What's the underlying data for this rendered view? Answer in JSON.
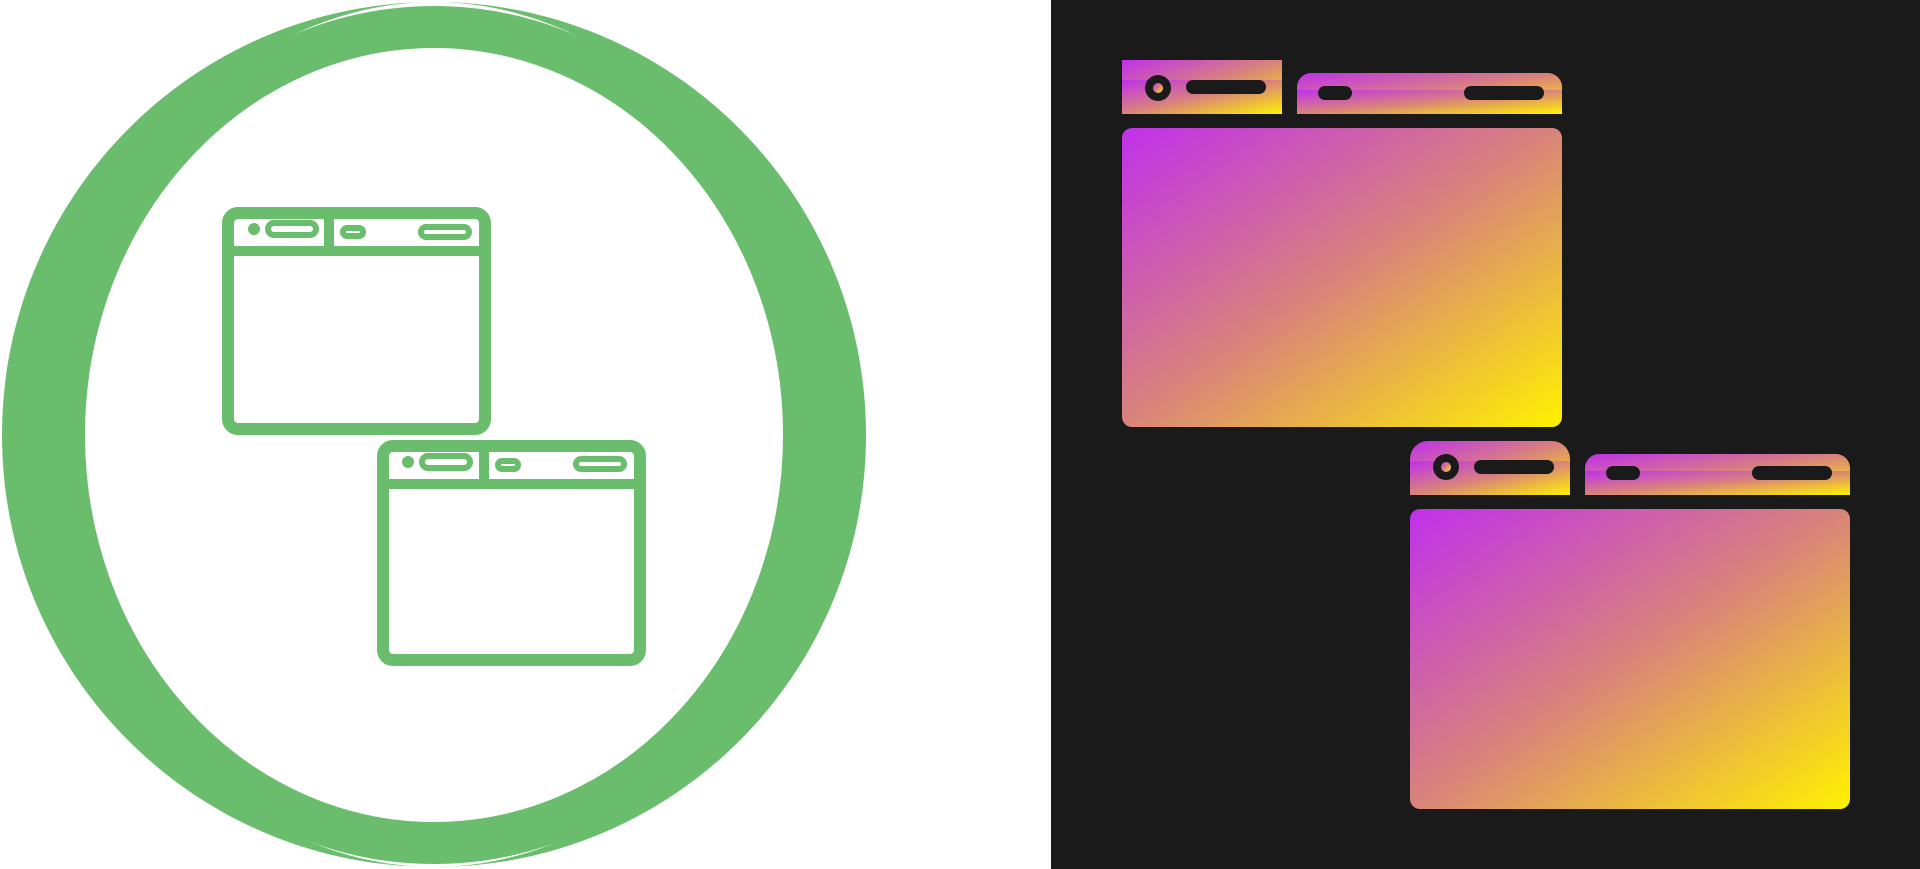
{
  "title": "",
  "panels": {
    "left": {
      "icon": "two-browser-windows-outline-icon",
      "style": "outline",
      "background": "#ffffff",
      "ring_color": "#6bbd6e",
      "icon_color": "#6bbd6e"
    },
    "right": {
      "icon": "two-browser-windows-gradient-icon",
      "style": "gradient-glyph",
      "background": "#1b1a1b",
      "gradient_start": "#c030ec",
      "gradient_mid": "#d9847a",
      "gradient_end": "#fff200",
      "cutout_color": "#1b1a1b"
    }
  }
}
